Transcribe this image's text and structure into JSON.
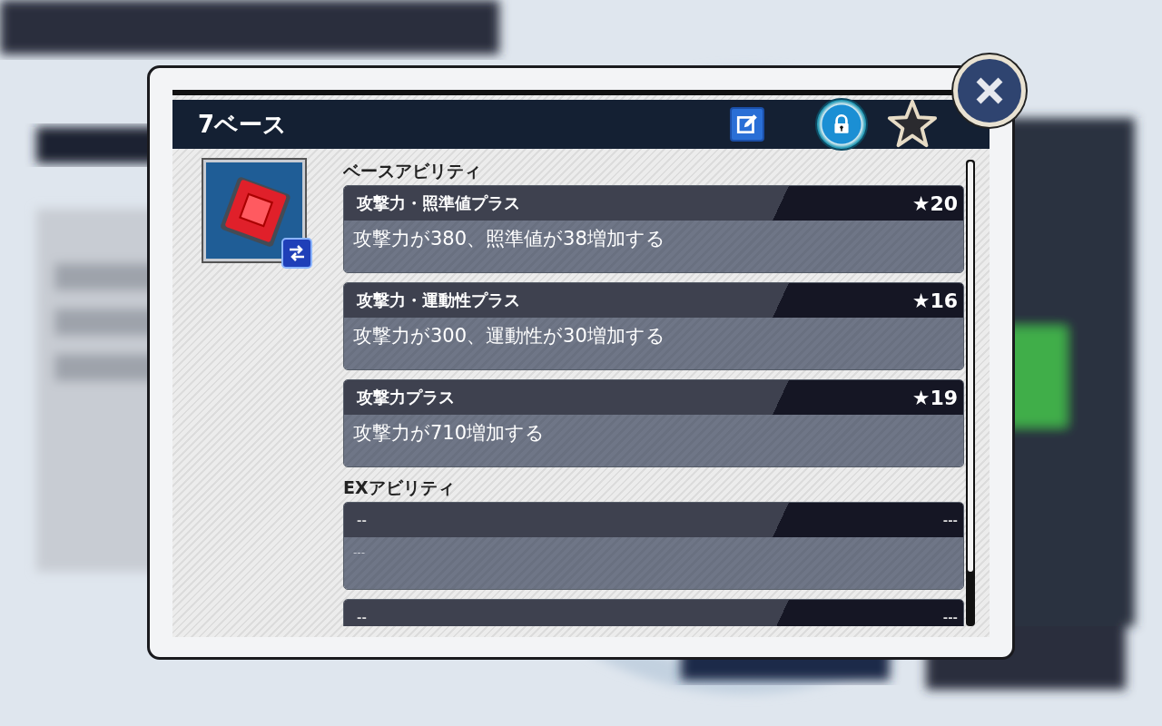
{
  "dialog": {
    "title": "7ベース",
    "sections": [
      {
        "heading": "ベースアビリティ",
        "abilities": [
          {
            "name": "攻撃力・照準値プラス",
            "rank": "★20",
            "description": "攻撃力が380、照準値が38増加する",
            "empty": false
          },
          {
            "name": "攻撃力・運動性プラス",
            "rank": "★16",
            "description": "攻撃力が300、運動性が30増加する",
            "empty": false
          },
          {
            "name": "攻撃力プラス",
            "rank": "★19",
            "description": "攻撃力が710増加する",
            "empty": false
          }
        ]
      },
      {
        "heading": "EXアビリティ",
        "abilities": [
          {
            "name": "--",
            "rank": "---",
            "description": "---",
            "empty": true
          },
          {
            "name": "--",
            "rank": "---",
            "empty": true
          }
        ]
      }
    ]
  }
}
